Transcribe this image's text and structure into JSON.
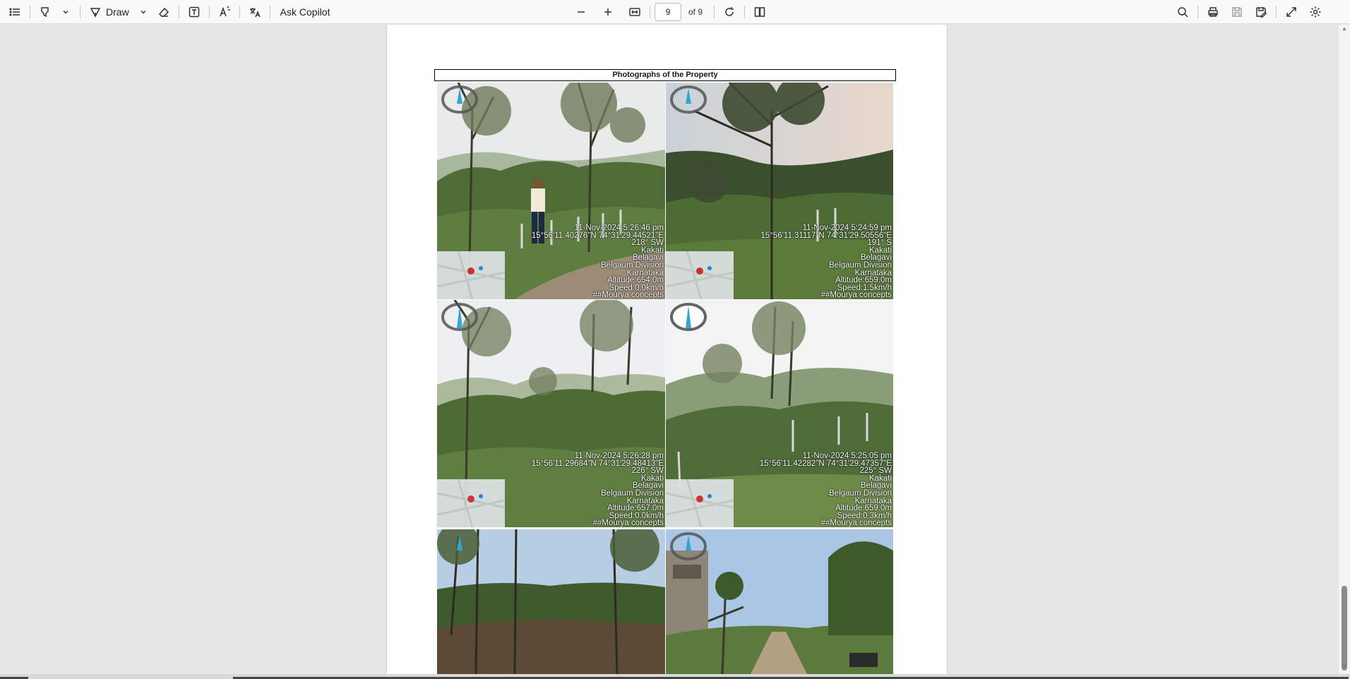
{
  "toolbar": {
    "draw_label": "Draw",
    "ask_copilot_label": "Ask Copilot",
    "current_page": "9",
    "page_of": "of 9"
  },
  "document": {
    "section_title": "Photographs of the Property",
    "photos": [
      {
        "lines": [
          "11-Nov-2024 5:26:46 pm",
          "15°56'11.40276\"N 74°31'29.44521\"E",
          "218° SW",
          "Kakati",
          "Belagavi",
          "Belgaum Division",
          "Karnataka",
          "Altitude:654.0m",
          "Speed:0.0km/h",
          "##Mourya concepts"
        ]
      },
      {
        "lines": [
          "11-Nov-2024 5:24:59 pm",
          "15°56'11.31117\"N 74°31'29.50556\"E",
          "191° S",
          "Kakati",
          "Belagavi",
          "Belgaum Division",
          "Karnataka",
          "Altitude:659.0m",
          "Speed:1.5km/h",
          "##Mourya concepts"
        ]
      },
      {
        "lines": [
          "11-Nov-2024 5:26:28 pm",
          "15°56'11.29684\"N 74°31'29.48413\"E",
          "226° SW",
          "Kakati",
          "Belagavi",
          "Belgaum Division",
          "Karnataka",
          "Altitude:657.0m",
          "Speed:0.0km/h",
          "##Mourya concepts"
        ]
      },
      {
        "lines": [
          "11-Nov-2024 5:25:05 pm",
          "15°56'11.42282\"N 74°31'29.47357\"E",
          "225° SW",
          "Kakati",
          "Belagavi",
          "Belgaum Division",
          "Karnataka",
          "Altitude:659.0m",
          "Speed:0.3km/h",
          "##Mourya concepts"
        ]
      }
    ]
  },
  "colors": {
    "sky_overcast": "#e9ecec",
    "vegetation_dark": "#3f5a2c",
    "vegetation_light": "#6f8e4a",
    "path_dirt": "#9c8b75",
    "sky_blue": "#a9c6e4",
    "compass_needle": "#2fa6d6"
  }
}
